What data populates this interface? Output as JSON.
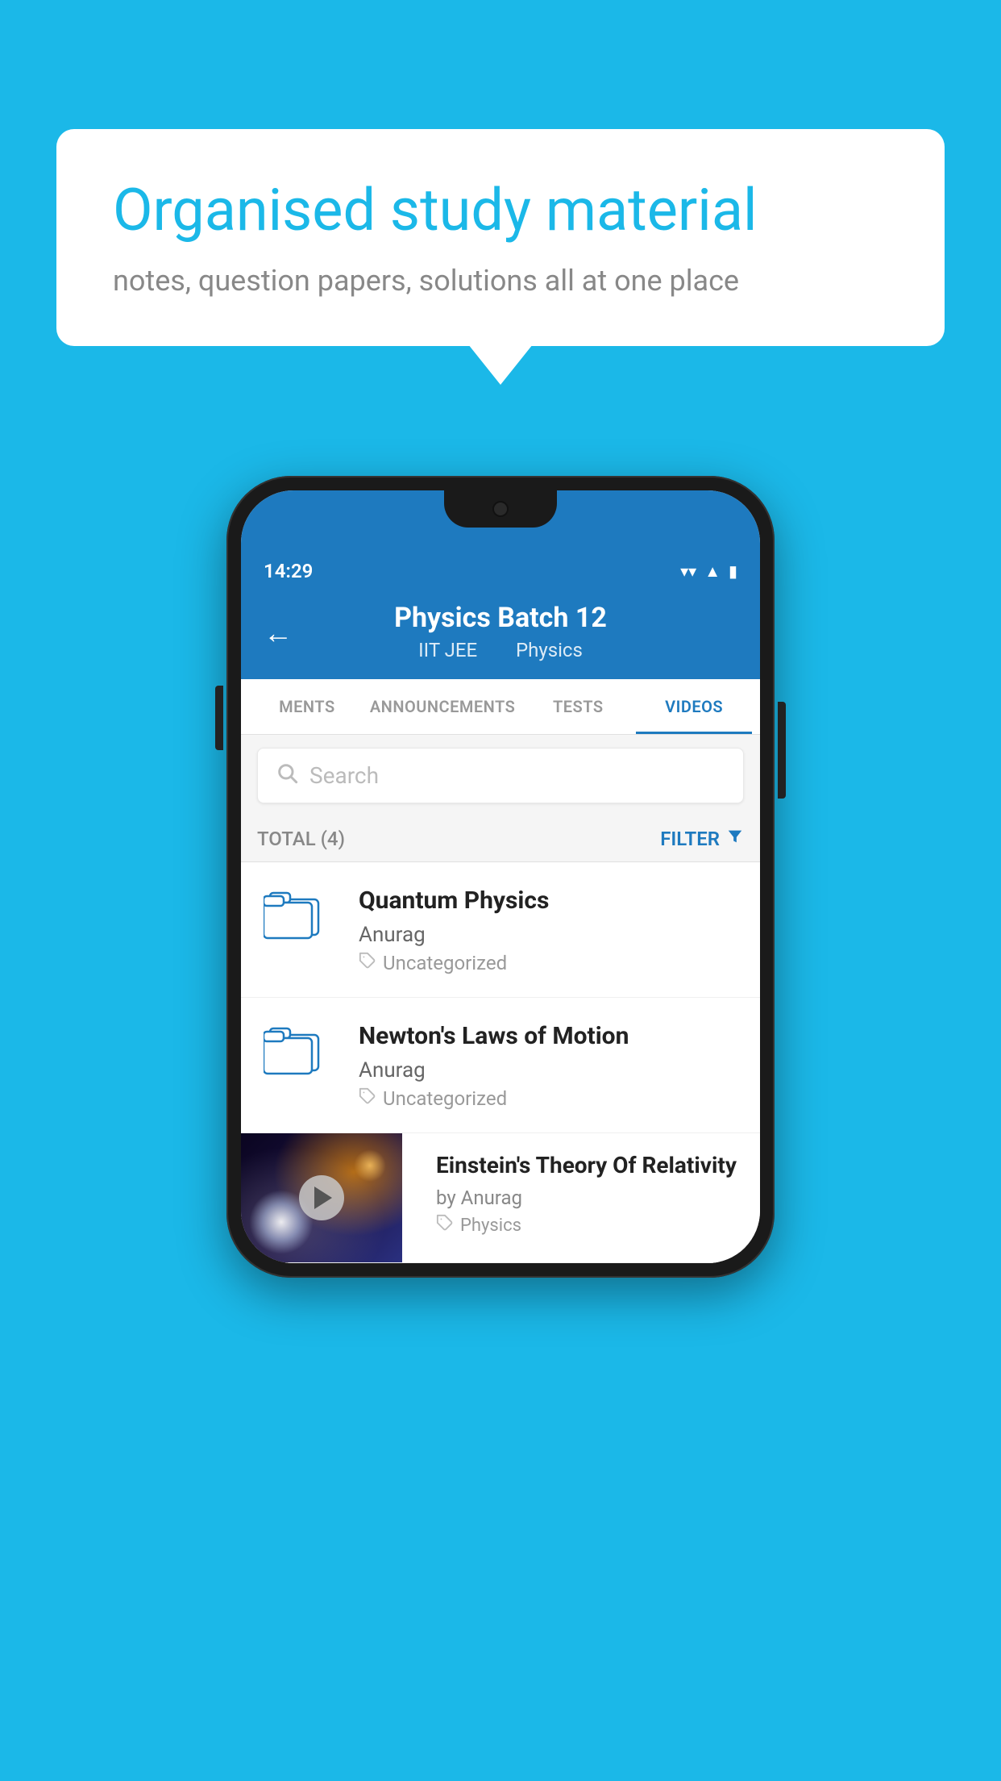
{
  "app": {
    "background_color": "#1bb8e8"
  },
  "speech_bubble": {
    "title": "Organised study material",
    "subtitle": "notes, question papers, solutions all at one place"
  },
  "phone": {
    "status_bar": {
      "time": "14:29",
      "wifi": "▼",
      "signal": "◀",
      "battery": "▮"
    },
    "header": {
      "back_label": "←",
      "title": "Physics Batch 12",
      "subtitle_part1": "IIT JEE",
      "subtitle_part2": "Physics"
    },
    "tabs": [
      {
        "label": "MENTS",
        "active": false
      },
      {
        "label": "ANNOUNCEMENTS",
        "active": false
      },
      {
        "label": "TESTS",
        "active": false
      },
      {
        "label": "VIDEOS",
        "active": true
      }
    ],
    "search": {
      "placeholder": "Search"
    },
    "filter_bar": {
      "total_label": "TOTAL (4)",
      "filter_label": "FILTER"
    },
    "videos": [
      {
        "id": 1,
        "title": "Quantum Physics",
        "author": "Anurag",
        "tag": "Uncategorized",
        "has_thumbnail": false
      },
      {
        "id": 2,
        "title": "Newton's Laws of Motion",
        "author": "Anurag",
        "tag": "Uncategorized",
        "has_thumbnail": false
      },
      {
        "id": 3,
        "title": "Einstein's Theory Of Relativity",
        "author": "by Anurag",
        "tag": "Physics",
        "has_thumbnail": true
      }
    ]
  }
}
